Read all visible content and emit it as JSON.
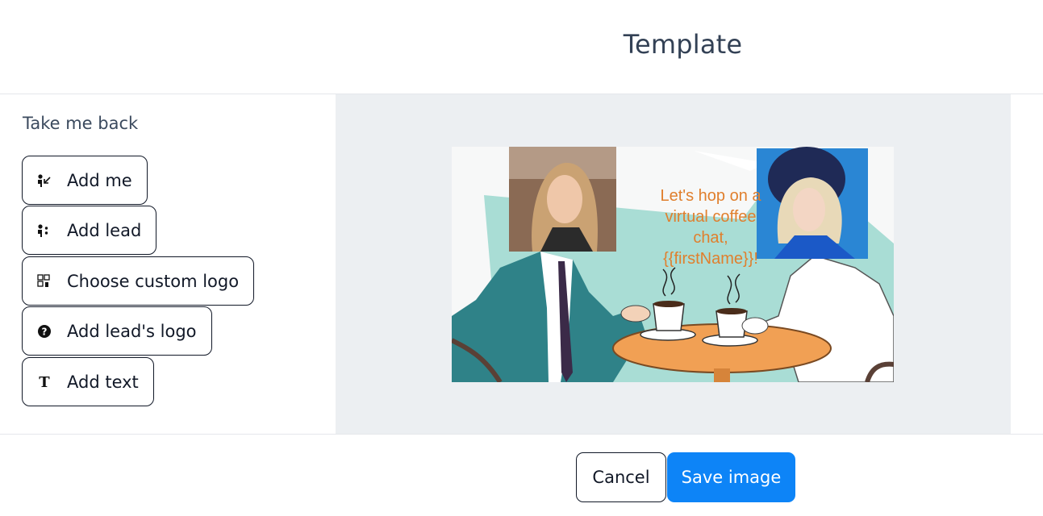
{
  "header": {
    "title": "Template"
  },
  "sidebar": {
    "back_label": "Take me back",
    "tools": [
      {
        "label": "Add me",
        "icon": "person-arrow-icon"
      },
      {
        "label": "Add lead",
        "icon": "person-lead-icon"
      },
      {
        "label": "Choose custom logo",
        "icon": "grid-logo-icon"
      },
      {
        "label": "Add lead's logo",
        "icon": "question-circle-icon"
      },
      {
        "label": "Add text",
        "icon": "text-t-icon"
      }
    ]
  },
  "preview": {
    "overlay_text_line1": "Let's hop on a",
    "overlay_text_line2": "virtual coffee",
    "overlay_text_line3": "chat,",
    "overlay_text_line4": "{{firstName}}!"
  },
  "footer": {
    "cancel_label": "Cancel",
    "save_label": "Save image"
  },
  "colors": {
    "accent": "#0d84f7",
    "overlay_text": "#e07f2d",
    "canvas_bg": "#eceff2"
  }
}
